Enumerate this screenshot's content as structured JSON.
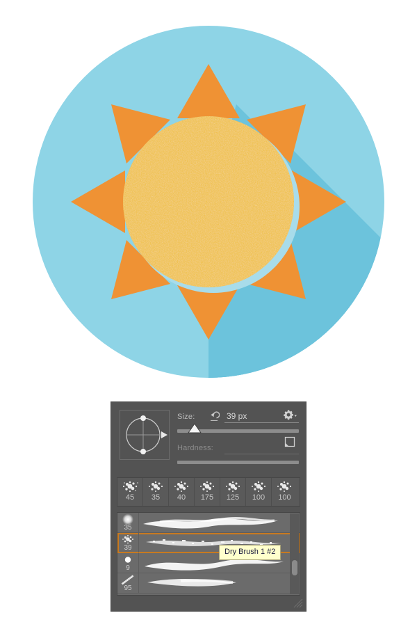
{
  "illustration": {
    "name": "flat-sun-icon",
    "colors": {
      "background_circle": "#8ed4e6",
      "long_shadow": "#6fc4dc",
      "ray_orange": "#ef9234",
      "sun_disc": "#efbe35",
      "sun_ring": "#a8dcea",
      "canvas": "#ffffff"
    },
    "ray_count": 8
  },
  "panel": {
    "name": "Brush Preset Picker",
    "size": {
      "label": "Size:",
      "value": "39 px",
      "reset_icon": "reset-arrow-icon",
      "slider_percent": 14
    },
    "hardness": {
      "label": "Hardness:",
      "value": "",
      "slider_percent": 100,
      "enabled": false
    },
    "buttons": {
      "gear": "gear-icon",
      "new_preset": "new-preset-icon"
    },
    "presets": [
      {
        "size": "45"
      },
      {
        "size": "35"
      },
      {
        "size": "40"
      },
      {
        "size": "175"
      },
      {
        "size": "125"
      },
      {
        "size": "100"
      },
      {
        "size": "100"
      }
    ],
    "brush_list": [
      {
        "size": "35",
        "tip": "soft-round",
        "selected": false
      },
      {
        "size": "39",
        "tip": "dry-brush",
        "selected": true
      },
      {
        "size": "9",
        "tip": "hard-round",
        "selected": false
      },
      {
        "size": "95",
        "tip": "angled-bristle",
        "selected": false
      }
    ],
    "tooltip": {
      "text": "Dry Brush 1 #2",
      "bg": "#ffffcc"
    },
    "scrollbar": {
      "thumb_top_percent": 58
    },
    "colors": {
      "panel_bg": "#535353",
      "list_bg": "#6b6b6b",
      "selection_outline": "#c87a20",
      "label_text": "#b9b9b9",
      "value_text": "#d6d6d6"
    }
  }
}
